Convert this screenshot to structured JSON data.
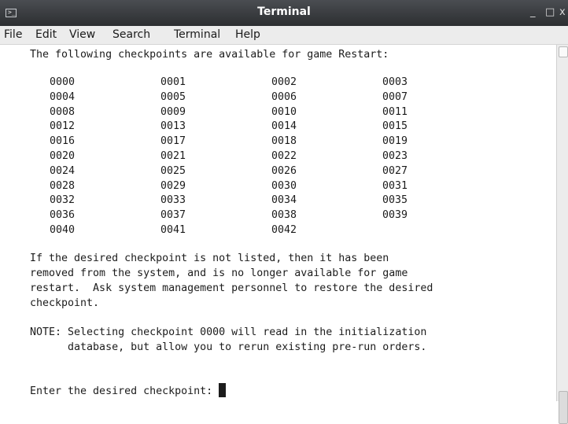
{
  "window": {
    "title": "Terminal",
    "app_icon_glyph": ">_",
    "minimize_glyph": "_",
    "maximize_glyph": "□",
    "close_glyph": "x"
  },
  "menu": [
    "File",
    "Edit",
    "View",
    "Search",
    "Terminal",
    "Help"
  ],
  "terminal": {
    "header": "The following checkpoints are available for game Restart:",
    "checkpoints": [
      [
        "0000",
        "0001",
        "0002",
        "0003"
      ],
      [
        "0004",
        "0005",
        "0006",
        "0007"
      ],
      [
        "0008",
        "0009",
        "0010",
        "0011"
      ],
      [
        "0012",
        "0013",
        "0014",
        "0015"
      ],
      [
        "0016",
        "0017",
        "0018",
        "0019"
      ],
      [
        "0020",
        "0021",
        "0022",
        "0023"
      ],
      [
        "0024",
        "0025",
        "0026",
        "0027"
      ],
      [
        "0028",
        "0029",
        "0030",
        "0031"
      ],
      [
        "0032",
        "0033",
        "0034",
        "0035"
      ],
      [
        "0036",
        "0037",
        "0038",
        "0039"
      ],
      [
        "0040",
        "0041",
        "0042"
      ]
    ],
    "paragraph": [
      "If the desired checkpoint is not listed, then it has been",
      "removed from the system, and is no longer available for game",
      "restart.  Ask system management personnel to restore the desired",
      "checkpoint."
    ],
    "note": [
      "NOTE: Selecting checkpoint 0000 will read in the initialization",
      "      database, but allow you to rerun existing pre-run orders."
    ],
    "prompt": "Enter the desired checkpoint: "
  }
}
